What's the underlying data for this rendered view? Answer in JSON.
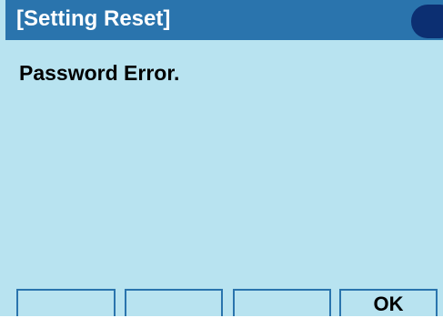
{
  "header": {
    "title": "[Setting Reset]"
  },
  "main": {
    "message": "Password Error."
  },
  "softkeys": [
    {
      "label": ""
    },
    {
      "label": ""
    },
    {
      "label": ""
    },
    {
      "label": "OK"
    }
  ],
  "colors": {
    "background": "#b8e3f0",
    "title_bar": "#2a74ad",
    "title_pill": "#0c2f72",
    "title_text": "#ffffff",
    "key_border": "#2a74ad"
  }
}
